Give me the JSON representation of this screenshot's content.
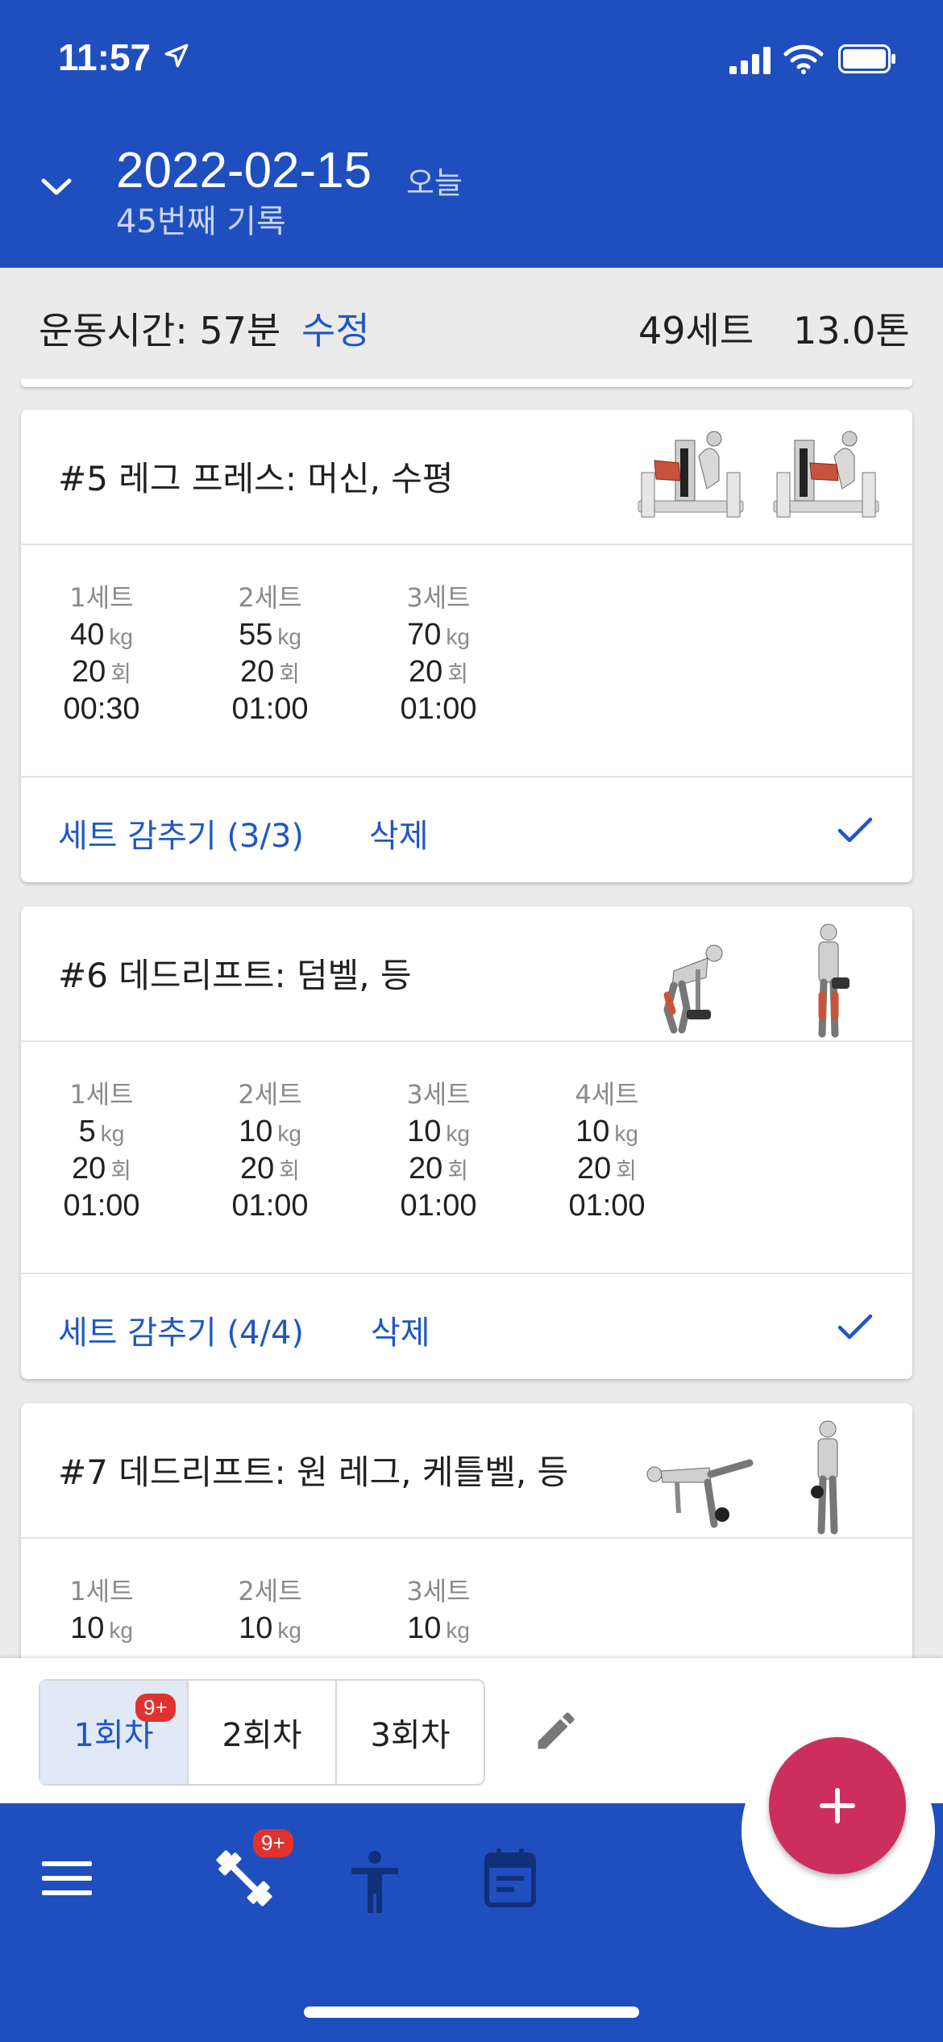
{
  "status": {
    "time": "11:57"
  },
  "header": {
    "date": "2022-02-15",
    "today": "오늘",
    "subtitle": "45번째 기록"
  },
  "summary": {
    "duration": "운동시간: 57분",
    "edit": "수정",
    "sets": "49세트",
    "tons": "13.0톤"
  },
  "cards": [
    {
      "title": "#5 레그 프레스: 머신, 수평",
      "sets": [
        {
          "label": "1세트",
          "weight": "40",
          "reps": "20",
          "time": "00:30"
        },
        {
          "label": "2세트",
          "weight": "55",
          "reps": "20",
          "time": "01:00"
        },
        {
          "label": "3세트",
          "weight": "70",
          "reps": "20",
          "time": "01:00"
        }
      ],
      "hide": "세트 감추기 (3/3)",
      "delete": "삭제"
    },
    {
      "title": "#6 데드리프트: 덤벨, 등",
      "sets": [
        {
          "label": "1세트",
          "weight": "5",
          "reps": "20",
          "time": "01:00"
        },
        {
          "label": "2세트",
          "weight": "10",
          "reps": "20",
          "time": "01:00"
        },
        {
          "label": "3세트",
          "weight": "10",
          "reps": "20",
          "time": "01:00"
        },
        {
          "label": "4세트",
          "weight": "10",
          "reps": "20",
          "time": "01:00"
        }
      ],
      "hide": "세트 감추기 (4/4)",
      "delete": "삭제"
    },
    {
      "title": "#7 데드리프트: 원 레그, 케틀벨, 등",
      "sets": [
        {
          "label": "1세트",
          "weight": "10"
        },
        {
          "label": "2세트",
          "weight": "10"
        },
        {
          "label": "3세트",
          "weight": "10"
        }
      ]
    }
  ],
  "units": {
    "kg": "kg",
    "reps": "회"
  },
  "rounds": {
    "items": [
      "1회차",
      "2회차",
      "3회차"
    ],
    "badge": "9+"
  },
  "nav": {
    "badge": "9+"
  },
  "colors": {
    "primary": "#1f4fbf",
    "accent": "#cc2f5e",
    "link": "#1f57c3",
    "badge": "#e0332f"
  }
}
